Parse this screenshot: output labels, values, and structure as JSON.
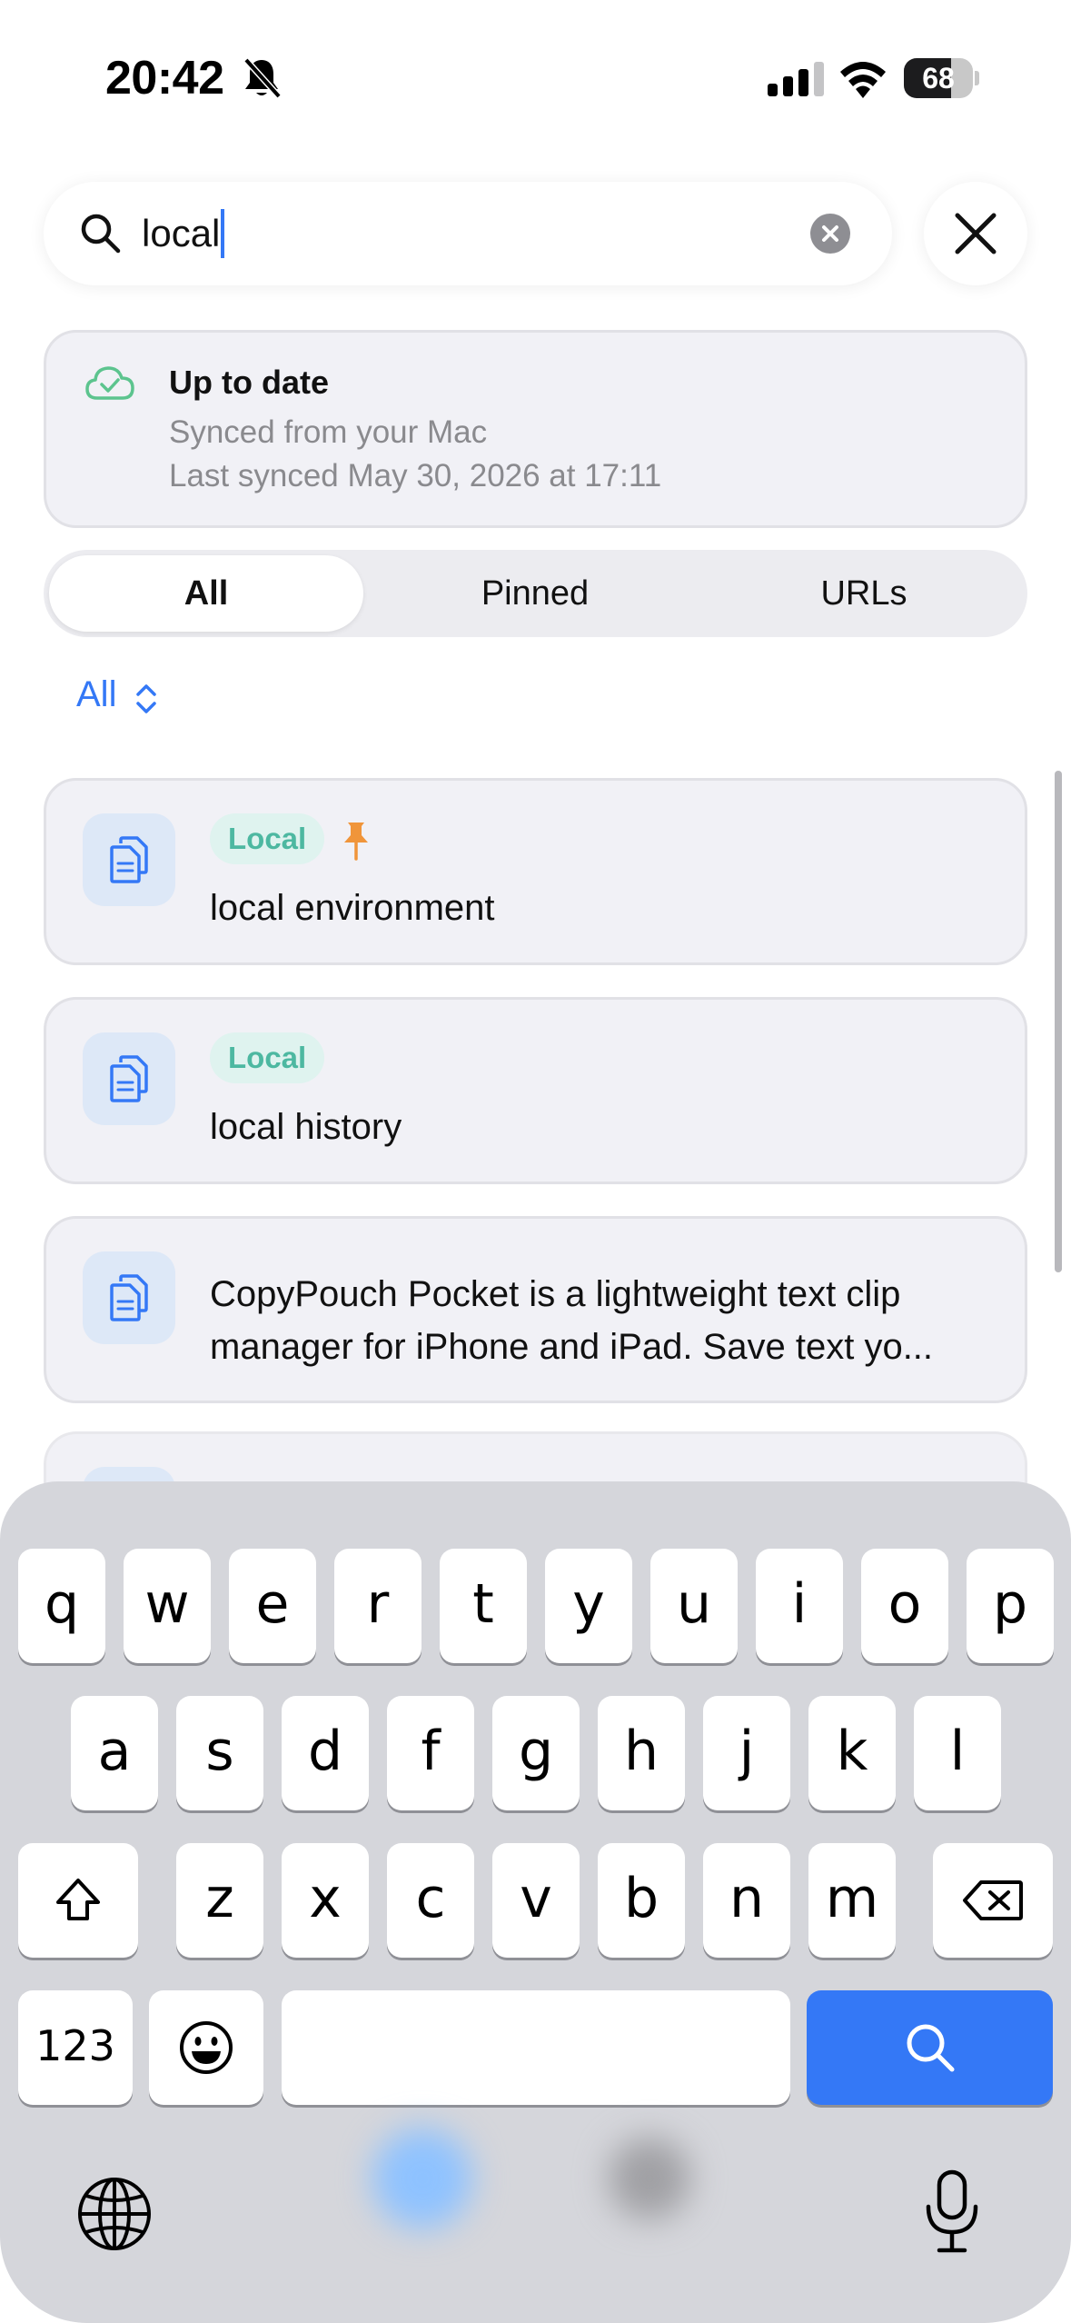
{
  "status_bar": {
    "time": "20:42",
    "battery_level": "68",
    "battery_fraction": 0.68
  },
  "search": {
    "query": "local",
    "icons": [
      "search-icon",
      "clear-icon",
      "close-icon"
    ]
  },
  "sync": {
    "title": "Up to date",
    "subtitle": "Synced from your Mac",
    "last_synced": "Last synced May 30, 2026 at 17:11",
    "icon": "cloud-check-icon",
    "icon_color": "#5cc48e"
  },
  "tabs": [
    {
      "label": "All",
      "active": true
    },
    {
      "label": "Pinned",
      "active": false
    },
    {
      "label": "URLs",
      "active": false
    }
  ],
  "filter": {
    "label": "All",
    "icon": "chevron-up-down-icon"
  },
  "clips": [
    {
      "badge": "Local",
      "pinned": true,
      "text": "local environment"
    },
    {
      "badge": "Local",
      "pinned": false,
      "text": "local history"
    },
    {
      "badge": "",
      "pinned": false,
      "text": "CopyPouch Pocket is a lightweight text clip manager for iPhone and iPad.  Save text yo..."
    }
  ],
  "keyboard": {
    "row1": [
      "q",
      "w",
      "e",
      "r",
      "t",
      "y",
      "u",
      "i",
      "o",
      "p"
    ],
    "row2": [
      "a",
      "s",
      "d",
      "f",
      "g",
      "h",
      "j",
      "k",
      "l"
    ],
    "row3": [
      "z",
      "x",
      "c",
      "v",
      "b",
      "n",
      "m"
    ],
    "numbers_label": "123"
  },
  "colors": {
    "accent": "#3478f6",
    "badge_text": "#4db8a1",
    "badge_bg": "#dff3ef",
    "pin": "#f0953a"
  }
}
